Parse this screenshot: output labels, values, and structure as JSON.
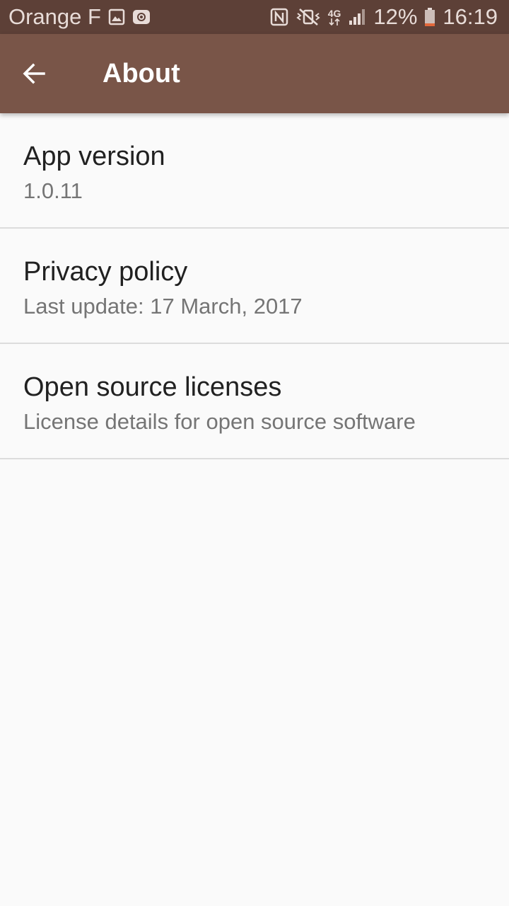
{
  "status_bar": {
    "carrier": "Orange F",
    "network": "4G",
    "battery": "12%",
    "time": "16:19",
    "icons": [
      "image-icon",
      "at-icon",
      "nfc-icon",
      "vibrate-icon",
      "network-4g-icon",
      "signal-icon",
      "battery-icon"
    ]
  },
  "app_bar": {
    "title": "About",
    "back_icon": "arrow-back-icon"
  },
  "items": [
    {
      "title": "App version",
      "subtitle": "1.0.11"
    },
    {
      "title": "Privacy policy",
      "subtitle": "Last update: 17 March, 2017"
    },
    {
      "title": "Open source licenses",
      "subtitle": "License details for open source software"
    }
  ],
  "colors": {
    "status_bar": "#5d4037",
    "app_bar": "#795548",
    "background": "#fafafa",
    "divider": "#dcdcdc",
    "battery_low": "#e2683b"
  }
}
